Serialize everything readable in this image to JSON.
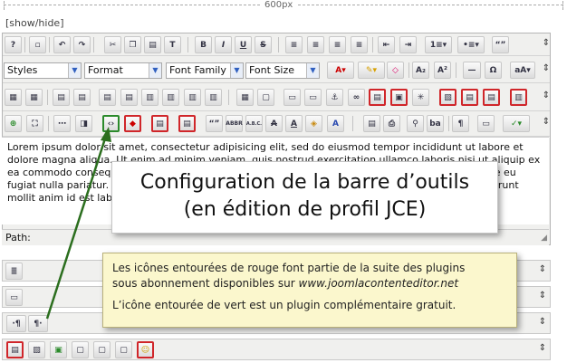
{
  "ruler": {
    "width_label": "600px"
  },
  "show_hide": "[show/hide]",
  "toolbar": {
    "styles": "Styles",
    "format": "Format",
    "font_family": "Font Family",
    "font_size": "Font Size",
    "bold": "B",
    "italic": "I",
    "underline": "U",
    "strike": "S",
    "omega": "Ω",
    "quote": "“”",
    "subscript": "A₂",
    "superscript": "A²",
    "abbr": "ABBR",
    "abc": "A.B.C.",
    "pilcrow": "¶"
  },
  "content_text": "Lorem ipsum dolor sit amet, consectetur adipisicing elit, sed do eiusmod tempor incididunt ut labore et dolore magna aliqua. Ut enim ad minim veniam, quis nostrud exercitation ullamco laboris nisi ut aliquip ex ea commodo consequat. Duis aute irure dolor in reprehenderit in voluptate velit esse cillum dolore eu fugiat nulla pariatur. Excepteur sint occaecat cupidatat non proident, sunt in culpa qui officia deserunt mollit anim id est laborum.",
  "path_label": "Path:",
  "callout": {
    "line1": "Configuration de la barre d’outils",
    "line2": "(en édition de profil JCE)"
  },
  "note": {
    "line1": "Les icônes entourées de rouge font partie de la suite des plugins",
    "line2": "sous abonnement disponibles sur",
    "site": "www.joomlacontenteditor.net",
    "line3": "L’icône entourée de vert est un plugin complémentaire gratuit."
  },
  "colors": {
    "red_outline": "#d0262a",
    "green_outline": "#2b8a2b",
    "note_bg": "#fbf7cd"
  }
}
